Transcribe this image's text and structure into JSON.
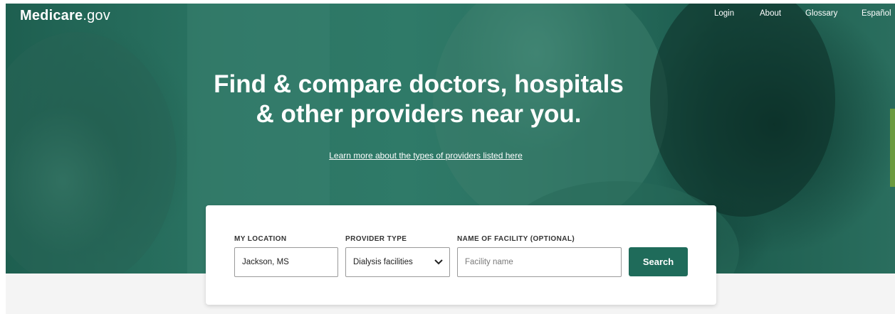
{
  "brand": {
    "logo_bold": "Medicare",
    "logo_suffix": ".gov"
  },
  "nav": {
    "login": "Login",
    "about": "About",
    "glossary": "Glossary",
    "language": "Español"
  },
  "hero": {
    "headline_line1": "Find & compare doctors, hospitals",
    "headline_line2": "& other providers near you.",
    "learn_more_link": "Learn more about the types of providers listed here"
  },
  "search": {
    "location_label": "MY LOCATION",
    "location_value": "Jackson, MS",
    "provider_label": "PROVIDER TYPE",
    "provider_value": "Dialysis facilities",
    "facility_label": "NAME OF FACILITY (OPTIONAL)",
    "facility_value": "",
    "facility_placeholder": "Facility name",
    "button_label": "Search"
  },
  "icons": {
    "dropdown": "chevron-down-icon"
  },
  "colors": {
    "hero_green": "#2b7463",
    "button_green": "#1f6b5a",
    "background": "#f4f4f4",
    "side_tab": "#6a9a3e"
  }
}
